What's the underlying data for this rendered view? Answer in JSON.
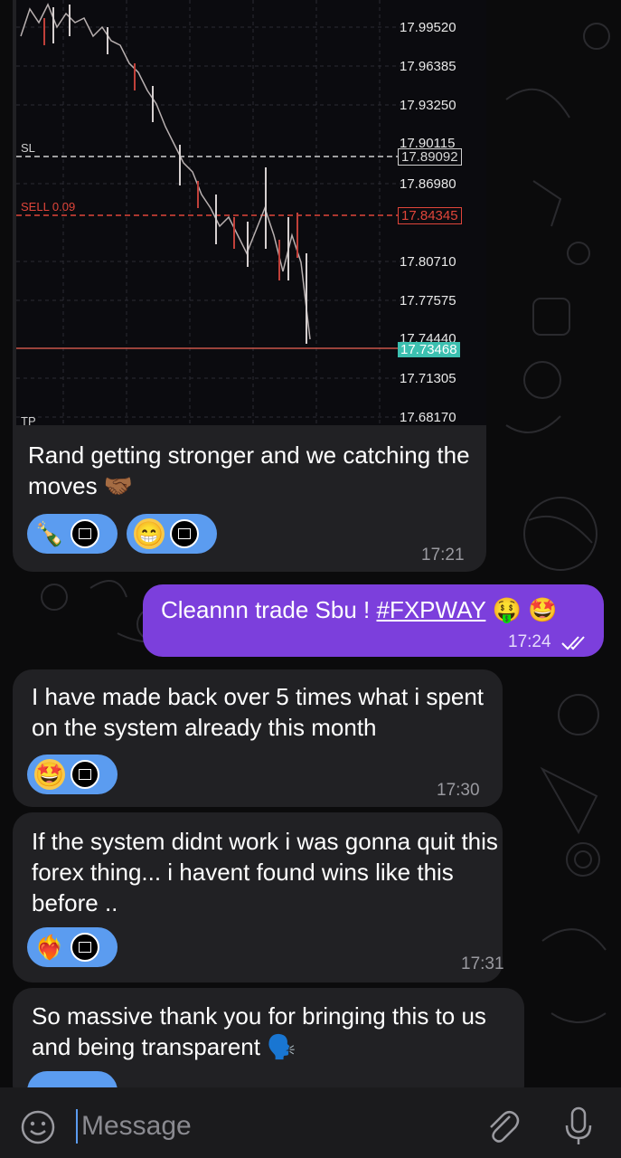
{
  "chart": {
    "prices": [
      "17.99520",
      "17.96385",
      "17.93250",
      "17.90115",
      "17.86980",
      "17.80710",
      "17.77575",
      "17.74440",
      "17.71305",
      "17.68170"
    ],
    "sl_label": "SL",
    "sl_price": "17.89092",
    "sell_label": "SELL 0.09",
    "sell_price": "17.84345",
    "current_price": "17.73468",
    "tp_label": "TP"
  },
  "messages": [
    {
      "text": "Rand getting stronger and we catching the moves",
      "emoji": "🤝🏾",
      "time": "17:21",
      "reactions": [
        "🍾",
        "😁"
      ]
    },
    {
      "text": "Cleannn trade Sbu ! ",
      "hashtag": "#FXPWAY",
      "emoji": "🤑 🤩",
      "time": "17:24",
      "outgoing": true
    },
    {
      "text": "I have made back over 5 times what i spent on the system already this month",
      "time": "17:30",
      "reactions": [
        "🤩"
      ]
    },
    {
      "text": "If the system didnt work i was gonna quit this forex thing... i havent found wins like this before ..",
      "time": "17:31",
      "reactions": [
        "❤️‍🔥"
      ]
    },
    {
      "text": "So massive thank you for bringing this to us and being transparent",
      "emoji": "🗣️"
    }
  ],
  "input": {
    "placeholder": "Message"
  },
  "colors": {
    "outgoing": "#7c3fdc",
    "incoming": "#212124",
    "reaction": "#5b9cf0",
    "sl_line": "#d6d6d6",
    "sell_line": "#e0453a",
    "current_line": "#3cc0b0"
  },
  "icons": [
    "emoji-icon",
    "attach-icon",
    "mic-icon",
    "read-check-icon"
  ]
}
